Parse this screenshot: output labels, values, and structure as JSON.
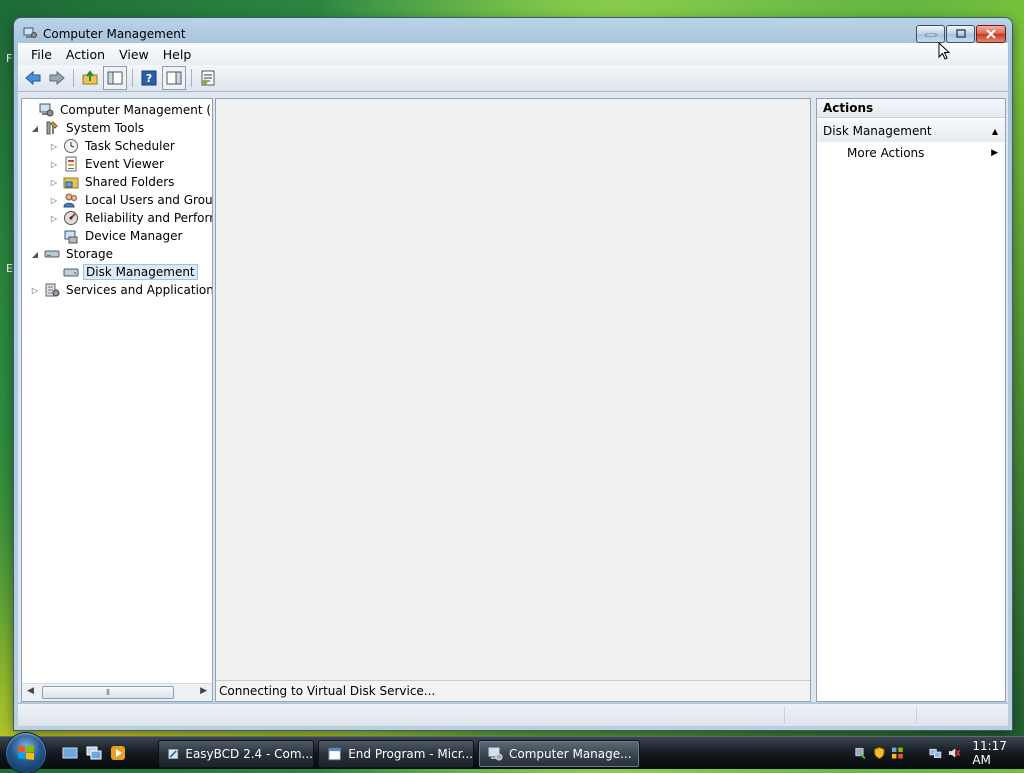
{
  "window": {
    "title": "Computer Management",
    "menu": [
      "File",
      "Action",
      "View",
      "Help"
    ]
  },
  "toolbar": {
    "buttons": [
      "back-icon",
      "forward-icon",
      "up-folder-icon",
      "show-hide-tree-icon",
      "help-icon",
      "show-hide-action-pane-icon",
      "properties-icon"
    ]
  },
  "tree": {
    "items": [
      {
        "label": "Computer Management (Local",
        "level": 0,
        "expander": "",
        "icon": "computer-management-icon"
      },
      {
        "label": "System Tools",
        "level": 1,
        "expander": "expanded",
        "icon": "tools-icon"
      },
      {
        "label": "Task Scheduler",
        "level": 2,
        "expander": "collapsed",
        "icon": "clock-icon"
      },
      {
        "label": "Event Viewer",
        "level": 2,
        "expander": "collapsed",
        "icon": "event-viewer-icon"
      },
      {
        "label": "Shared Folders",
        "level": 2,
        "expander": "collapsed",
        "icon": "shared-folder-icon"
      },
      {
        "label": "Local Users and Groups",
        "level": 2,
        "expander": "collapsed",
        "icon": "users-icon"
      },
      {
        "label": "Reliability and Performa",
        "level": 2,
        "expander": "collapsed",
        "icon": "performance-icon"
      },
      {
        "label": "Device Manager",
        "level": 2,
        "expander": "",
        "icon": "device-manager-icon"
      },
      {
        "label": "Storage",
        "level": 1,
        "expander": "expanded",
        "icon": "storage-icon"
      },
      {
        "label": "Disk Management",
        "level": 2,
        "expander": "",
        "icon": "disk-icon",
        "selected": true
      },
      {
        "label": "Services and Applications",
        "level": 1,
        "expander": "collapsed",
        "icon": "services-icon"
      }
    ]
  },
  "center": {
    "status_text": "Connecting to Virtual Disk Service..."
  },
  "actions": {
    "header": "Actions",
    "section": "Disk Management",
    "items": [
      "More Actions"
    ]
  },
  "taskbar": {
    "buttons": [
      {
        "label": "EasyBCD 2.4 - Com...",
        "active": false
      },
      {
        "label": "End Program - Micr...",
        "active": false
      },
      {
        "label": "Computer Manage...",
        "active": true
      }
    ],
    "clock": "11:17 AM"
  },
  "colors": {
    "titlebar": "#b9d3e8",
    "selection": "#dceaf7",
    "taskbar": "#141a20",
    "close_button": "#c23a22"
  }
}
